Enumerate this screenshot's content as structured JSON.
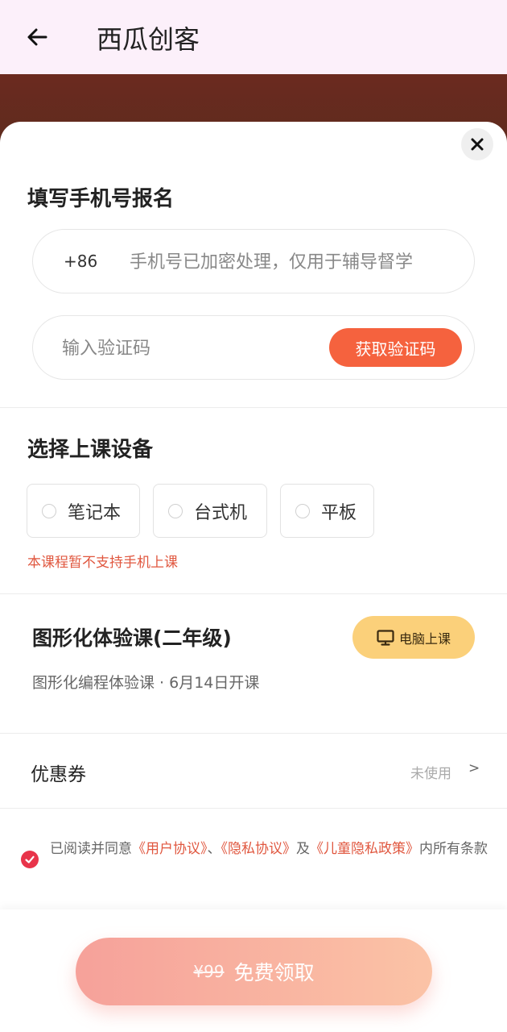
{
  "header": {
    "title": "西瓜创客"
  },
  "signup": {
    "title": "填写手机号报名",
    "phone_prefix": "+86",
    "phone_placeholder": "手机号已加密处理，仅用于辅导督学",
    "code_placeholder": "输入验证码",
    "code_button": "获取验证码"
  },
  "device": {
    "title": "选择上课设备",
    "options": [
      "笔记本",
      "台式机",
      "平板"
    ],
    "warning": "本课程暂不支持手机上课"
  },
  "course": {
    "title": "图形化体验课(二年级)",
    "tag": "电脑上课",
    "subtitle": "图形化编程体验课 · 6月14日开课"
  },
  "coupon": {
    "label": "优惠券",
    "status": "未使用",
    "arrow": ">"
  },
  "agreement": {
    "prefix": "已阅读并同意",
    "link1": "《用户协议》",
    "sep1": "、",
    "link2": "《隐私协议》",
    "sep2": "及",
    "link3": "《儿童隐私政策》",
    "suffix": "内所有条款"
  },
  "cta": {
    "old_price": "¥99",
    "label": "免费领取"
  },
  "colors": {
    "accent": "#f5623e",
    "warning": "#e0573f",
    "tag": "#fbd07a",
    "check": "#e8344a"
  },
  "icons": [
    "back-arrow-icon",
    "close-icon",
    "monitor-icon",
    "check-icon"
  ]
}
